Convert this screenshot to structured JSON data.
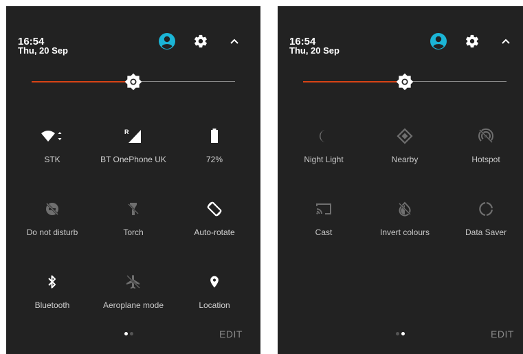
{
  "colors": {
    "panel_bg": "#222222",
    "accent": "#1bb5d6",
    "slider_fill": "#d84315",
    "icon_active": "#ffffff",
    "icon_inactive": "#6f6f6f",
    "edit": "#8a8a8a"
  },
  "panels": [
    {
      "time": "16:54",
      "date": "Thu, 20 Sep",
      "header_icons": [
        "account-icon",
        "settings-gear-icon",
        "chevron-up-icon"
      ],
      "brightness_level": 0.5,
      "tiles": [
        {
          "label": "STK",
          "icon": "wifi-icon",
          "active": true
        },
        {
          "label": "BT OnePhone UK",
          "icon": "cell-signal-roaming-icon",
          "active": true
        },
        {
          "label": "72%",
          "icon": "battery-icon",
          "active": true
        },
        {
          "label": "Do not disturb",
          "icon": "do-not-disturb-off-icon",
          "active": false
        },
        {
          "label": "Torch",
          "icon": "flashlight-off-icon",
          "active": false
        },
        {
          "label": "Auto-rotate",
          "icon": "screen-rotation-icon",
          "active": true
        },
        {
          "label": "Bluetooth",
          "icon": "bluetooth-icon",
          "active": true
        },
        {
          "label": "Aeroplane mode",
          "icon": "airplane-off-icon",
          "active": false
        },
        {
          "label": "Location",
          "icon": "location-pin-icon",
          "active": true
        }
      ],
      "page_index": 0,
      "edit_label": "EDIT"
    },
    {
      "time": "16:54",
      "date": "Thu, 20 Sep",
      "header_icons": [
        "account-icon",
        "settings-gear-icon",
        "chevron-up-icon"
      ],
      "brightness_level": 0.5,
      "tiles": [
        {
          "label": "Night Light",
          "icon": "night-light-moon-icon",
          "active": false
        },
        {
          "label": "Nearby",
          "icon": "nearby-diamond-icon",
          "active": false
        },
        {
          "label": "Hotspot",
          "icon": "hotspot-off-icon",
          "active": false
        },
        {
          "label": "Cast",
          "icon": "cast-icon",
          "active": false
        },
        {
          "label": "Invert colours",
          "icon": "invert-colours-off-icon",
          "active": false
        },
        {
          "label": "Data Saver",
          "icon": "data-saver-icon",
          "active": false
        }
      ],
      "page_index": 1,
      "edit_label": "EDIT"
    }
  ]
}
